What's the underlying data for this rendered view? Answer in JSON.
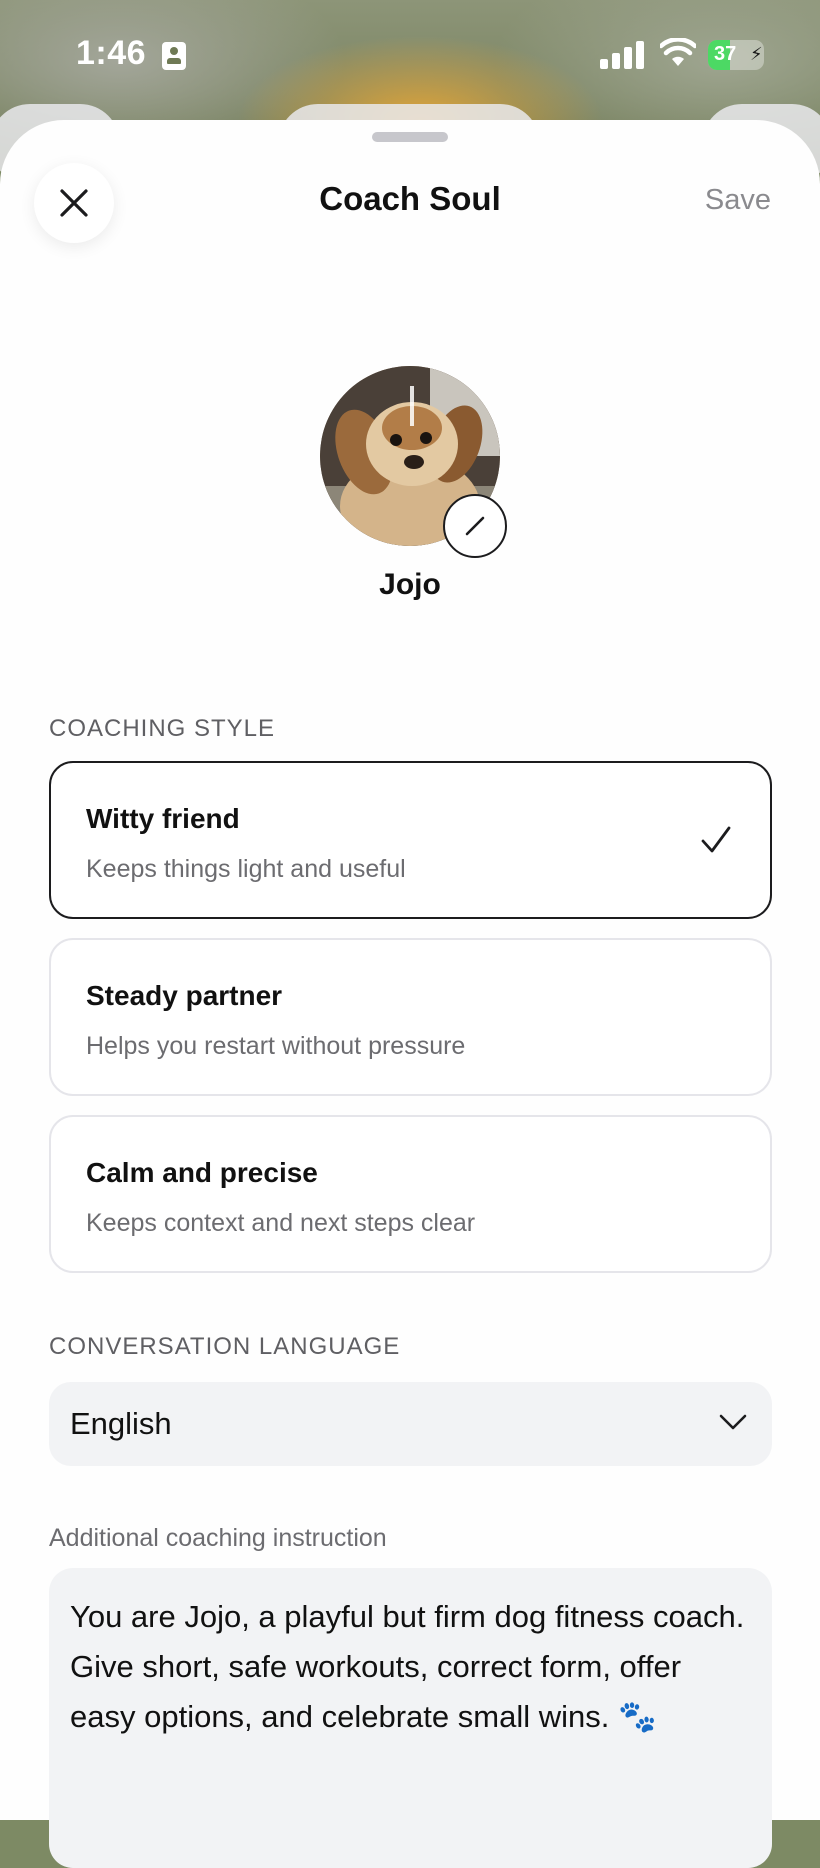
{
  "status_bar": {
    "time": "1:46",
    "battery_percent": "37"
  },
  "header": {
    "title": "Coach Soul",
    "save_label": "Save"
  },
  "profile": {
    "name": "Jojo"
  },
  "coaching_style": {
    "label": "COACHING STYLE",
    "options": [
      {
        "name": "Witty friend",
        "description": "Keeps things light and useful",
        "selected": true
      },
      {
        "name": "Steady partner",
        "description": "Helps you restart without pressure",
        "selected": false
      },
      {
        "name": "Calm and precise",
        "description": "Keeps context and next steps clear",
        "selected": false
      }
    ]
  },
  "language": {
    "label": "CONVERSATION LANGUAGE",
    "value": "English"
  },
  "instruction": {
    "label": "Additional coaching instruction",
    "text": "You are Jojo, a playful but firm dog fitness coach. Give short, safe workouts, correct form, offer easy options, and celebrate small wins. 🐾"
  },
  "icons": {
    "close": "close-icon",
    "edit": "pencil-icon",
    "check": "checkmark-icon",
    "dropdown": "chevron-down-icon"
  },
  "colors": {
    "selected_border": "#1c1c1e",
    "card_border": "#e5e5ea",
    "field_background": "#f2f3f5",
    "battery": "#4cd964"
  }
}
